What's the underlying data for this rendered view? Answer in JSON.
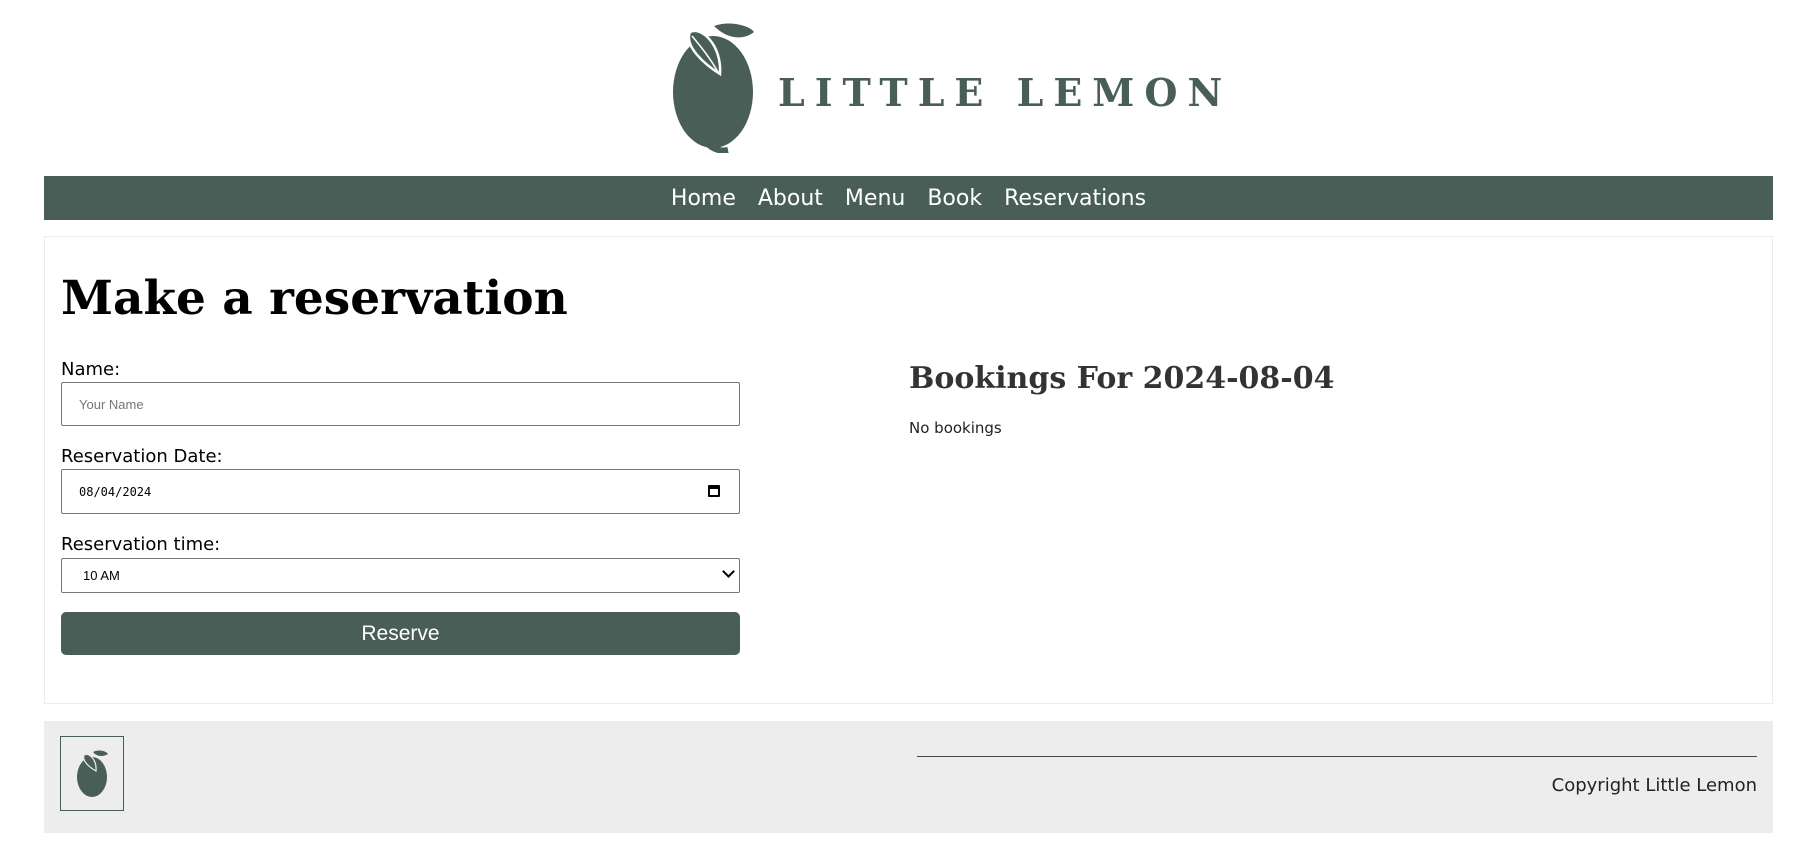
{
  "brand": {
    "name": "LITTLE LEMON",
    "color": "#495e57"
  },
  "nav": {
    "items": [
      {
        "label": "Home"
      },
      {
        "label": "About"
      },
      {
        "label": "Menu"
      },
      {
        "label": "Book"
      },
      {
        "label": "Reservations"
      }
    ]
  },
  "form": {
    "title": "Make a reservation",
    "name_label": "Name:",
    "name_placeholder": "Your Name",
    "date_label": "Reservation Date:",
    "date_value": "08/04/2024",
    "time_label": "Reservation time:",
    "time_value": "10 AM",
    "submit_label": "Reserve"
  },
  "bookings": {
    "title": "Bookings For 2024-08-04",
    "empty_text": "No bookings"
  },
  "footer": {
    "copyright": "Copyright Little Lemon"
  },
  "icons": {
    "logo": "lemon-icon",
    "calendar": "calendar-icon",
    "dropdown": "chevron-down-icon"
  }
}
